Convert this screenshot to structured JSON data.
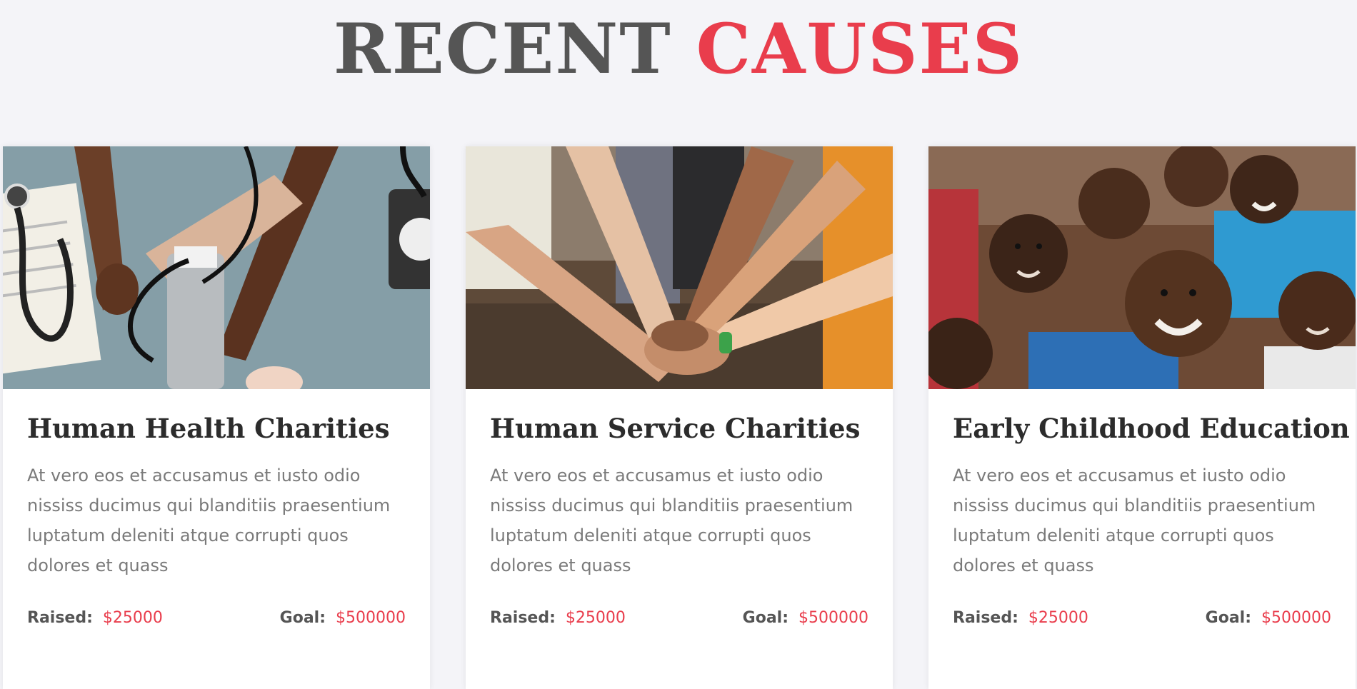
{
  "section": {
    "title_part1": "RECENT",
    "title_part2": "CAUSES"
  },
  "colors": {
    "accent": "#e93d4c",
    "title_dark": "#555555",
    "background": "#f4f4f8"
  },
  "causes": [
    {
      "image": "doctor-measuring-blood-pressure",
      "title": "Human Health Charities",
      "description": "At vero eos et accusamus et iusto odio nississ ducimus qui blanditiis praesentium luptatum deleniti atque corrupti quos dolores et quass",
      "raised_label": "Raised:",
      "raised_value": "$25000",
      "goal_label": "Goal:",
      "goal_value": "$500000"
    },
    {
      "image": "stacked-hands-teamwork",
      "title": "Human Service Charities",
      "description": "At vero eos et accusamus et iusto odio nississ ducimus qui blanditiis praesentium luptatum deleniti atque corrupti quos dolores et quass",
      "raised_label": "Raised:",
      "raised_value": "$25000",
      "goal_label": "Goal:",
      "goal_value": "$500000"
    },
    {
      "image": "smiling-children-group",
      "title": "Early Childhood Education",
      "description": "At vero eos et accusamus et iusto odio nississ ducimus qui blanditiis praesentium luptatum deleniti atque corrupti quos dolores et quass",
      "raised_label": "Raised:",
      "raised_value": "$25000",
      "goal_label": "Goal:",
      "goal_value": "$500000"
    }
  ]
}
